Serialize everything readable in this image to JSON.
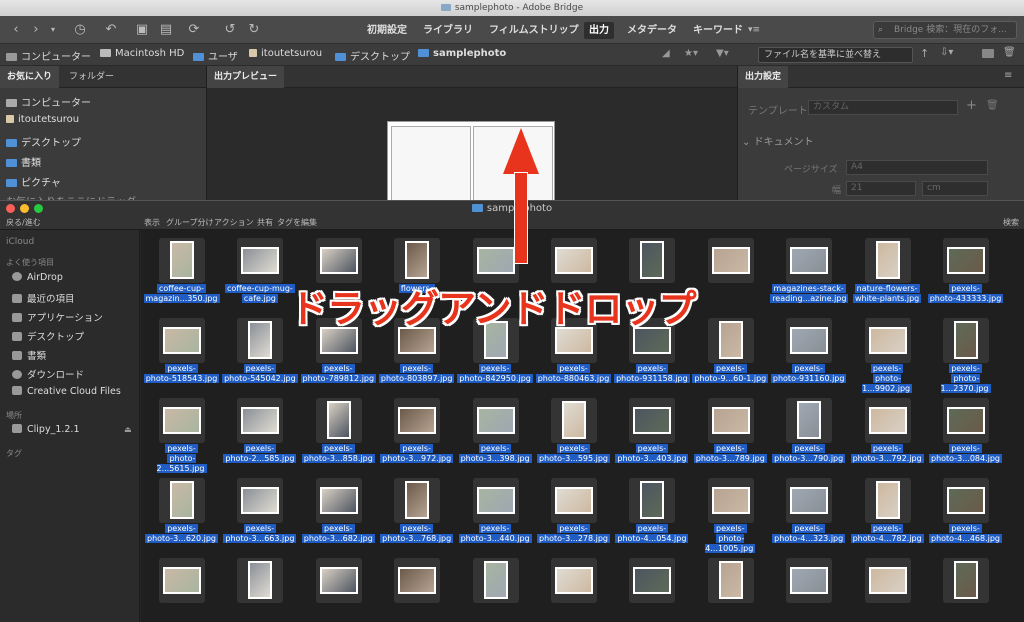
{
  "bridge": {
    "title": "samplephoto - Adobe Bridge",
    "workspaces": [
      "初期設定",
      "ライブラリ",
      "フィルムストリップ",
      "出力",
      "メタデータ",
      "キーワード"
    ],
    "active_workspace": "出力",
    "search_placeholder": "Bridge 検索：現在のフォ...",
    "path": [
      "コンピューター",
      "Macintosh HD",
      "ユーザ",
      "itoutetsurou",
      "デスクトップ",
      "samplephoto"
    ],
    "sort": "ファイル名を基準に並べ替え",
    "fav_tabs": [
      "お気に入り",
      "フォルダー"
    ],
    "favorites": [
      "コンピューター",
      "itoutetsurou",
      "デスクトップ",
      "書類",
      "ピクチャ",
      "お気に入りをここにドラッグ"
    ],
    "preview_tab": "出力プレビュー",
    "settings_tab": "出力設定",
    "settings": {
      "template_label": "テンプレート",
      "template_value": "カスタム",
      "document_label": "ドキュメント",
      "page_size_label": "ページサイズ",
      "page_size_value": "A4",
      "width_label": "幅",
      "width_value": "21",
      "unit": "cm"
    }
  },
  "finder": {
    "title": "samplephoto",
    "toolbar": {
      "back": "戻る/進む",
      "view": "表示",
      "group": "グループ分け",
      "action": "アクション",
      "share": "共有",
      "tags": "タグを編集",
      "search": "検索"
    },
    "sidebar": {
      "icloud": "iCloud",
      "favorites_header": "よく使う項目",
      "favorites": [
        "AirDrop",
        "最近の項目",
        "アプリケーション",
        "デスクトップ",
        "書類",
        "ダウンロード",
        "Creative Cloud Files"
      ],
      "locations_header": "場所",
      "device": "Clipy_1.2.1",
      "tags_header": "タグ"
    },
    "files": [
      [
        "coffee-cup-",
        "magazin...350.jpg"
      ],
      [
        "coffee-cup-mug-",
        "cafe.jpg"
      ],
      [
        "",
        ""
      ],
      [
        "flowers-",
        ""
      ],
      [
        "",
        ""
      ],
      [
        "",
        ""
      ],
      [
        "",
        ""
      ],
      [
        "",
        ""
      ],
      [
        "magazines-stack-",
        "reading...azine.jpg"
      ],
      [
        "nature-flowers-",
        "white-plants.jpg"
      ],
      [
        "pexels-",
        "photo-433333.jpg"
      ],
      [
        "pexels-",
        "photo-518543.jpg"
      ],
      [
        "pexels-",
        "photo-545042.jpg"
      ],
      [
        "pexels-",
        "photo-789812.jpg"
      ],
      [
        "pexels-",
        "photo-803897.jpg"
      ],
      [
        "pexels-",
        "photo-842950.jpg"
      ],
      [
        "pexels-",
        "photo-880463.jpg"
      ],
      [
        "pexels-",
        "photo-931158.jpg"
      ],
      [
        "pexels-",
        "photo-9...60-1.jpg"
      ],
      [
        "pexels-",
        "photo-931160.jpg"
      ],
      [
        "pexels-",
        "photo-1...9902.jpg"
      ],
      [
        "pexels-",
        "photo-1...2370.jpg"
      ],
      [
        "pexels-",
        "photo-2...5615.jpg"
      ],
      [
        "pexels-",
        "photo-2...585.jpg"
      ],
      [
        "pexels-",
        "photo-3...858.jpg"
      ],
      [
        "pexels-",
        "photo-3...972.jpg"
      ],
      [
        "pexels-",
        "photo-3...398.jpg"
      ],
      [
        "pexels-",
        "photo-3...595.jpg"
      ],
      [
        "pexels-",
        "photo-3...403.jpg"
      ],
      [
        "pexels-",
        "photo-3...789.jpg"
      ],
      [
        "pexels-",
        "photo-3...790.jpg"
      ],
      [
        "pexels-",
        "photo-3...792.jpg"
      ],
      [
        "pexels-",
        "photo-3...084.jpg"
      ],
      [
        "pexels-",
        "photo-3...620.jpg"
      ],
      [
        "pexels-",
        "photo-3...663.jpg"
      ],
      [
        "pexels-",
        "photo-3...682.jpg"
      ],
      [
        "pexels-",
        "photo-3...768.jpg"
      ],
      [
        "pexels-",
        "photo-3...440.jpg"
      ],
      [
        "pexels-",
        "photo-3...278.jpg"
      ],
      [
        "pexels-",
        "photo-4...054.jpg"
      ],
      [
        "pexels-",
        "photo-4...1005.jpg"
      ],
      [
        "pexels-",
        "photo-4...323.jpg"
      ],
      [
        "pexels-",
        "photo-4...782.jpg"
      ],
      [
        "pexels-",
        "photo-4...468.jpg"
      ],
      [
        "",
        ""
      ],
      [
        "",
        ""
      ],
      [
        "",
        ""
      ],
      [
        "",
        ""
      ],
      [
        "",
        ""
      ],
      [
        "",
        ""
      ],
      [
        "",
        ""
      ],
      [
        "",
        ""
      ],
      [
        "",
        ""
      ],
      [
        "",
        ""
      ],
      [
        "",
        ""
      ]
    ]
  },
  "overlay_text": "ドラッグアンドドロップ",
  "colors": {
    "accent": "#e8341c",
    "selection": "#1f5cc4",
    "folder": "#4f90d6"
  }
}
